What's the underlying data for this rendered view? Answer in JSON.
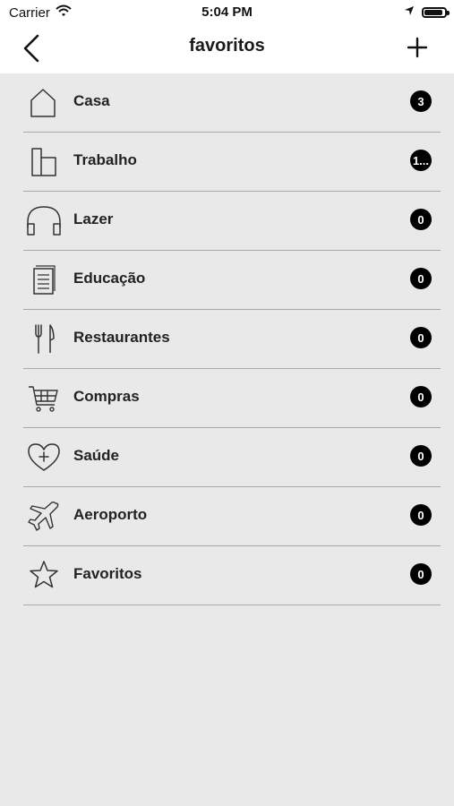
{
  "status_bar": {
    "carrier": "Carrier",
    "time": "5:04 PM",
    "battery_level": 0.9
  },
  "nav": {
    "title": "favoritos",
    "back_icon": "chevron-left-icon",
    "add_icon": "plus-icon"
  },
  "colors": {
    "background": "#e9e9e9",
    "badge": "#000000",
    "separator": "#a8a8a8"
  },
  "categories": [
    {
      "label": "Casa",
      "count": "3",
      "icon": "house-icon"
    },
    {
      "label": "Trabalho",
      "count": "1...",
      "icon": "building-icon"
    },
    {
      "label": "Lazer",
      "count": "0",
      "icon": "headphones-icon"
    },
    {
      "label": "Educação",
      "count": "0",
      "icon": "notebook-icon"
    },
    {
      "label": "Restaurantes",
      "count": "0",
      "icon": "fork-knife-icon"
    },
    {
      "label": "Compras",
      "count": "0",
      "icon": "shopping-cart-icon"
    },
    {
      "label": "Saúde",
      "count": "0",
      "icon": "heart-plus-icon"
    },
    {
      "label": "Aeroporto",
      "count": "0",
      "icon": "airplane-icon"
    },
    {
      "label": "Favoritos",
      "count": "0",
      "icon": "star-icon"
    }
  ]
}
